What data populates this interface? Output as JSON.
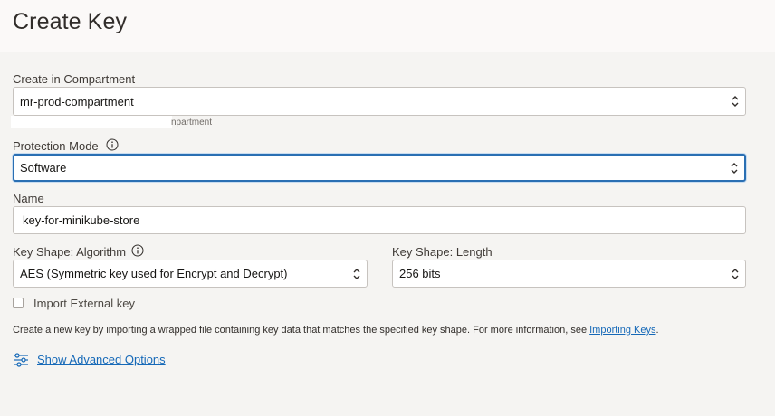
{
  "header": {
    "title": "Create Key"
  },
  "compartment": {
    "label": "Create in Compartment",
    "value": "mr-prod-compartment",
    "helper": "npartment"
  },
  "protection_mode": {
    "label": "Protection Mode",
    "value": "Software"
  },
  "name": {
    "label": "Name",
    "value": "key-for-minikube-store"
  },
  "algorithm": {
    "label": "Key Shape: Algorithm",
    "value": "AES (Symmetric key used for Encrypt and Decrypt)"
  },
  "length": {
    "label": "Key Shape: Length",
    "value": "256 bits"
  },
  "import": {
    "label": "Import External key",
    "checked": false,
    "description_prefix": "Create a new key by importing a wrapped file containing key data that matches the specified key shape. For more information, see ",
    "description_link": "Importing Keys",
    "description_suffix": "."
  },
  "advanced": {
    "label": "Show Advanced Options"
  },
  "icons": {
    "info": "info-icon",
    "chevron": "chevron-updown-icon",
    "settings": "sliders-icon"
  },
  "colors": {
    "link": "#1669b8",
    "focus_border": "#2a6fb3",
    "background": "#f5f4f2"
  }
}
